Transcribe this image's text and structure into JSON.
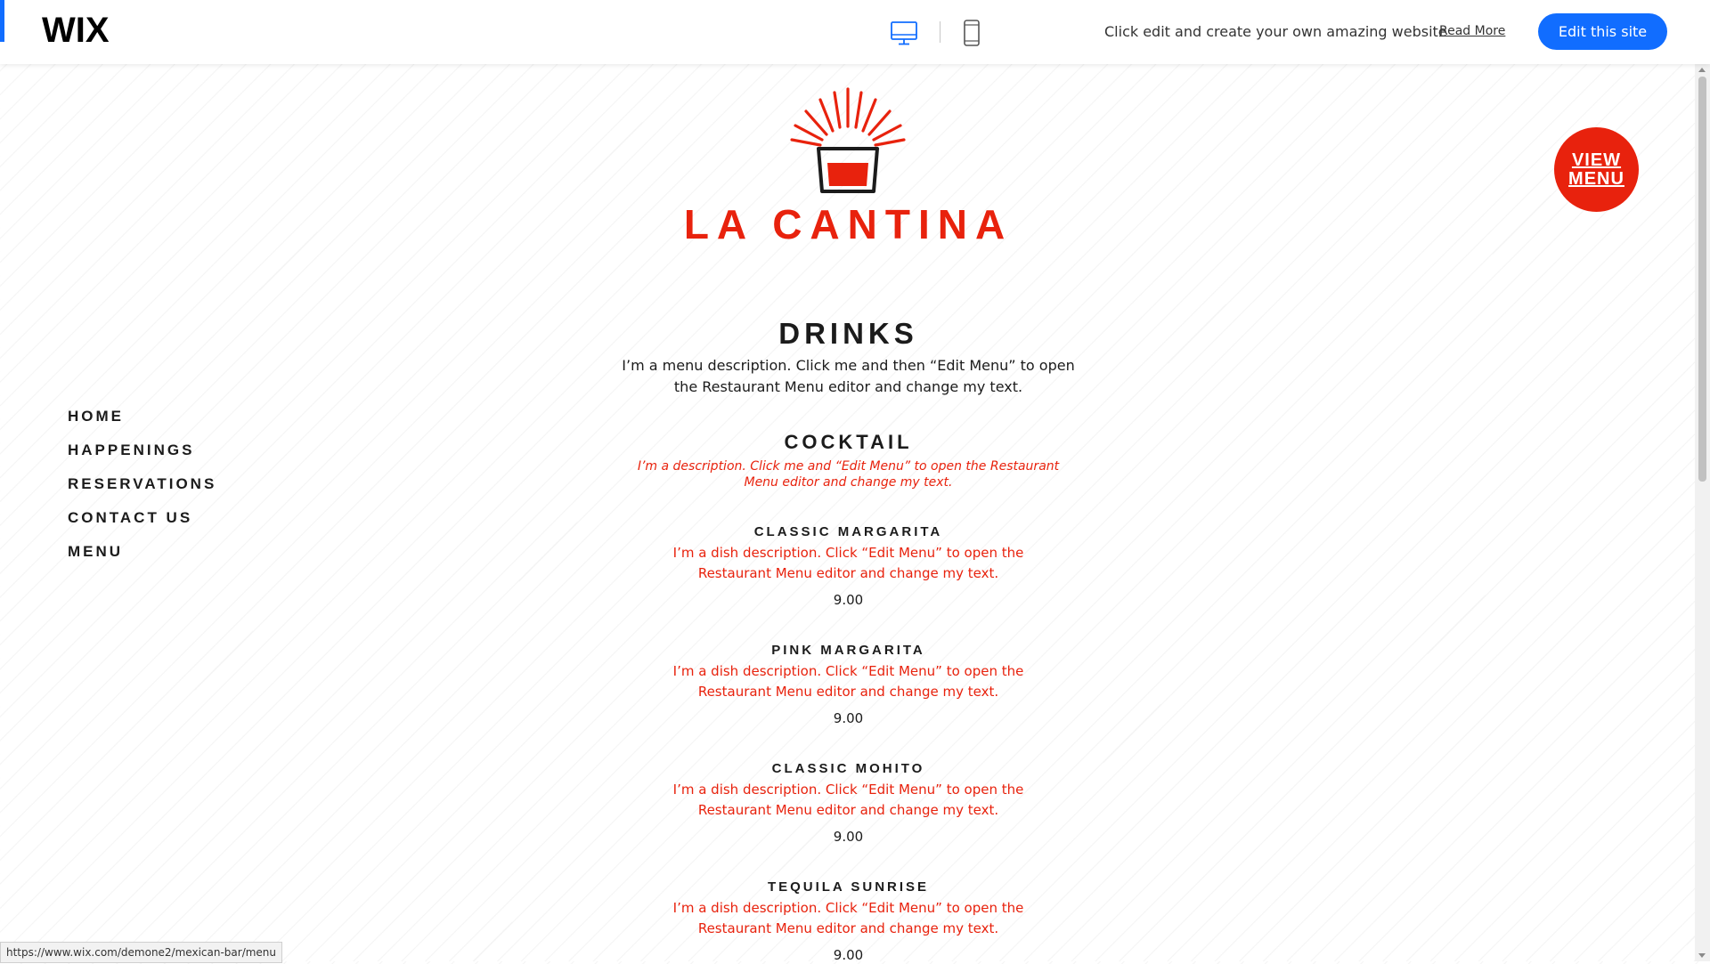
{
  "wix_bar": {
    "logo": "WIX",
    "desktop_view_icon": "desktop-monitor-icon",
    "mobile_view_icon": "mobile-phone-icon",
    "promo_text": "Click edit and create your own amazing website",
    "read_more": "Read More",
    "edit_button": "Edit this site",
    "accent_color": "#116dff"
  },
  "brand": {
    "name": "LA CANTINA",
    "logo_icon": "cocktail-glass-sunburst-icon",
    "color": "#e8220d"
  },
  "view_menu_badge": {
    "line1": "VIEW",
    "line2": "MENU"
  },
  "nav": {
    "items": [
      {
        "label": "HOME"
      },
      {
        "label": "HAPPENINGS"
      },
      {
        "label": "RESERVATIONS"
      },
      {
        "label": "CONTACT US"
      },
      {
        "label": "MENU"
      }
    ]
  },
  "menu": {
    "title": "DRINKS",
    "description": "I’m a menu description. Click me and then “Edit Menu” to open the Restaurant Menu editor and change my text.",
    "section": {
      "title": "COCKTAIL",
      "description": "I’m a description. Click me and “Edit Menu” to open the Restaurant Menu editor and change my text."
    },
    "dishes": [
      {
        "name": "CLASSIC MARGARITA",
        "description": "I’m a dish description. Click “Edit Menu” to open the Restaurant Menu editor and change my text.",
        "price": "9.00"
      },
      {
        "name": "PINK MARGARITA",
        "description": "I’m a dish description. Click “Edit Menu” to open the Restaurant Menu editor and change my text.",
        "price": "9.00"
      },
      {
        "name": "CLASSIC MOHITO",
        "description": "I’m a dish description. Click “Edit Menu” to open the Restaurant Menu editor and change my text.",
        "price": "9.00"
      },
      {
        "name": "TEQUILA SUNRISE",
        "description": "I’m a dish description. Click “Edit Menu” to open the Restaurant Menu editor and change my text.",
        "price": "9.00"
      }
    ]
  },
  "status_bar": {
    "url": "https://www.wix.com/demone2/mexican-bar/menu"
  }
}
